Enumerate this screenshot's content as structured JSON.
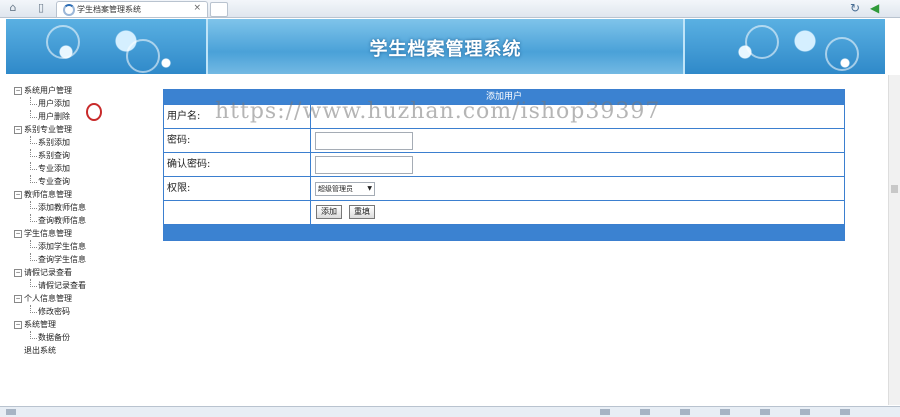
{
  "browser": {
    "tab_title": "学生档案管理系统",
    "close_glyph": "×",
    "back_glyph": "◀",
    "doc_glyph": "▯",
    "home_glyph": "⌂",
    "refresh_glyph": "↻"
  },
  "banner": {
    "title": "学生档案管理系统"
  },
  "sidebar": {
    "expand_glyph": "−",
    "groups": [
      {
        "label": "系统用户管理",
        "items": [
          "用户添加",
          "用户删除"
        ]
      },
      {
        "label": "系别专业管理",
        "items": [
          "系别添加",
          "系别查询",
          "专业添加",
          "专业查询"
        ]
      },
      {
        "label": "教师信息管理",
        "items": [
          "添加教师信息",
          "查询教师信息"
        ]
      },
      {
        "label": "学生信息管理",
        "items": [
          "添加学生信息",
          "查询学生信息"
        ]
      },
      {
        "label": "请假记录查看",
        "items": [
          "请假记录查看"
        ]
      },
      {
        "label": "个人信息管理",
        "items": [
          "修改密码"
        ]
      },
      {
        "label": "系统管理",
        "items": [
          "数据备份"
        ]
      }
    ],
    "exit_label": "退出系统"
  },
  "form": {
    "title": "添加用户",
    "username_label": "用户名:",
    "password_label": "密码:",
    "confirm_label": "确认密码:",
    "role_label": "权限:",
    "role_selected": "超级管理员",
    "select_arrow": "▼",
    "add_button": "添加",
    "reset_button": "重填"
  },
  "watermark": "https://www.huzhan.com/ishop39397",
  "colors": {
    "accent": "#3b82d1",
    "banner": "#4aa1d8",
    "cursor": "#c82a2a"
  }
}
